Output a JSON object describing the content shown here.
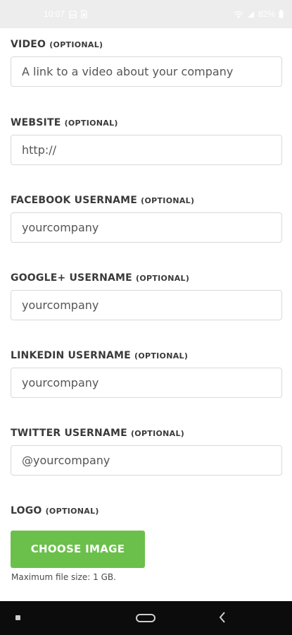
{
  "status_bar": {
    "time": "10:07",
    "battery": "82%",
    "icons": [
      "gallery-icon",
      "sim-icon",
      "wifi-icon",
      "signal-icon",
      "battery-icon"
    ]
  },
  "form": {
    "optional_tag": "(OPTIONAL)",
    "video": {
      "label": "VIDEO",
      "placeholder": "A link to a video about your company"
    },
    "website": {
      "label": "WEBSITE",
      "value": "http://"
    },
    "facebook": {
      "label": "FACEBOOK USERNAME",
      "placeholder": "yourcompany"
    },
    "google": {
      "label": "GOOGLE+ USERNAME",
      "placeholder": "yourcompany"
    },
    "linkedin": {
      "label": "LINKEDIN USERNAME",
      "placeholder": "yourcompany"
    },
    "twitter": {
      "label": "TWITTER USERNAME",
      "placeholder": "@yourcompany"
    },
    "logo": {
      "label": "LOGO",
      "button_label": "CHOOSE IMAGE",
      "note": "Maximum file size: 1 GB."
    }
  },
  "colors": {
    "button": "#6bc04b",
    "status_bar": "#ededed",
    "nav_bar": "#0c0c0c"
  }
}
